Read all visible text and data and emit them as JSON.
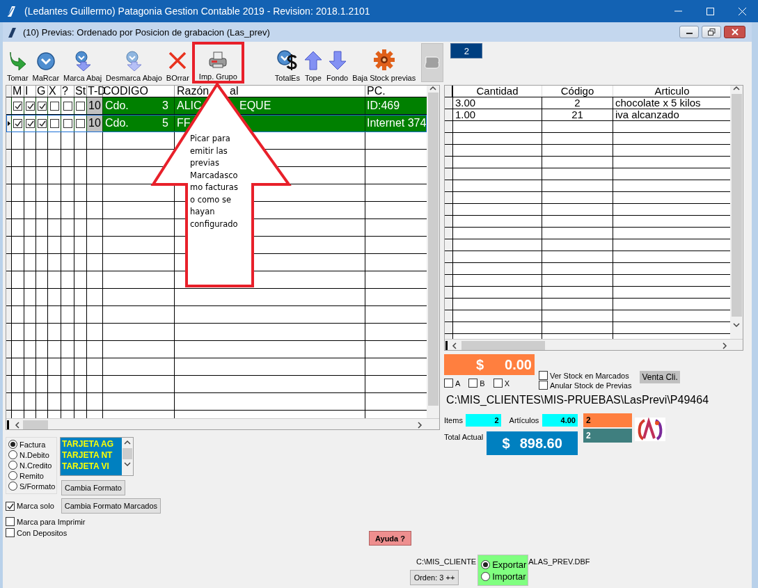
{
  "window": {
    "title": "(Ledantes Guillermo) Patagonia Gestion Contable 2019 - Revision: 2018.1.2101"
  },
  "child_window": {
    "title": "(10) Previas: Ordenado por Posicion de grabacion (Las_prev)"
  },
  "toolbar": [
    {
      "label": "Tomar",
      "kind": "take"
    },
    {
      "label": "MaRcar",
      "kind": "mark"
    },
    {
      "label": "Marca Abaj",
      "kind": "mark-down"
    },
    {
      "label": "Desmarca Abajo",
      "kind": "unmark-down"
    },
    {
      "label": "BOrrar",
      "kind": "delete"
    },
    {
      "label": "Imp. Grupo",
      "kind": "print",
      "highlighted": true
    },
    {
      "label": "TotalEs",
      "kind": "totals"
    },
    {
      "label": "Tope",
      "kind": "top"
    },
    {
      "label": "Fondo",
      "kind": "bottom"
    },
    {
      "label": "Baja Stock previas",
      "kind": "stock"
    }
  ],
  "page_counter": "2",
  "previas": {
    "header": {
      "checks": [
        "M",
        "I",
        "G",
        "X",
        "?",
        "St"
      ],
      "td": "T-D",
      "codigo": "CODIGO",
      "razon_start": "Razón",
      "razon_end": "al",
      "pc": "PC."
    },
    "rows": [
      {
        "checks": [
          true,
          true,
          true,
          false,
          false,
          false
        ],
        "td": "10",
        "codigo_tipo": "Cdo.",
        "codigo_num": "3",
        "razon_start": "ALIC",
        "razon_end": "EQUE",
        "pc": "ID:469",
        "current": false
      },
      {
        "checks": [
          true,
          true,
          true,
          false,
          false,
          false
        ],
        "td": "10",
        "codigo_tipo": "Cdo.",
        "codigo_num": "5",
        "razon_start": "FF",
        "razon_end": "",
        "pc": "Internet 374",
        "current": true
      }
    ]
  },
  "items": {
    "columns": [
      "Cantidad",
      "Código",
      "Articulo"
    ],
    "rows": [
      [
        "3.00",
        "2",
        "chocolate x 5 kilos"
      ],
      [
        "1.00",
        "21",
        "iva alcanzado"
      ]
    ]
  },
  "saldo": {
    "currency": "$",
    "amount": "0.00"
  },
  "letter_filters": [
    {
      "label": "A",
      "checked": false
    },
    {
      "label": "B",
      "checked": false
    },
    {
      "label": "X",
      "checked": false
    }
  ],
  "stock_options": [
    {
      "label": "Ver Stock en Marcados",
      "checked": false
    },
    {
      "label": "Anular Stock de Previas",
      "checked": false
    }
  ],
  "venta_cli": "Venta Cli.",
  "path": "C:\\MIS_CLIENTES\\MIS-PRUEBAS\\LasPrevi\\P49464",
  "totals": {
    "items_label": "Items",
    "items": "2",
    "articulos_label": "Artículos",
    "articulos": "4.00",
    "total_label": "Total Actual",
    "total_currency": "$",
    "total": "898.60",
    "box_1": "2",
    "box_2": "2"
  },
  "formats": [
    {
      "label": "Factura",
      "selected": true
    },
    {
      "label": "N.Debito",
      "selected": false
    },
    {
      "label": "N.Credito",
      "selected": false
    },
    {
      "label": "Remito",
      "selected": false
    },
    {
      "label": "S/Formato",
      "selected": false
    }
  ],
  "tarjetas": [
    "TARJETA AG",
    "TARJETA NT",
    "TARJETA VI"
  ],
  "cambia_formato": "Cambia Formato",
  "cambia_formato_marcados": "Cambia Formato Marcados",
  "options": [
    {
      "label": "Marca solo",
      "checked": true
    },
    {
      "label": "Marca para Imprimir",
      "checked": false
    },
    {
      "label": "Con Depositos",
      "checked": false
    }
  ],
  "help": "Ayuda ?",
  "db_path": {
    "start": "C:\\MIS_CLIENTE",
    "end": "ALAS_PREV.DBF"
  },
  "transfer": [
    {
      "label": "Exportar",
      "selected": true
    },
    {
      "label": "Importar",
      "selected": false
    }
  ],
  "order_button": "Orden: 3 ++",
  "callout": {
    "lines": [
      "Picar para",
      "emitir las",
      "previas",
      "Marcadasco",
      "mo facturas",
      "o como se",
      "hayan",
      "configurado"
    ]
  }
}
